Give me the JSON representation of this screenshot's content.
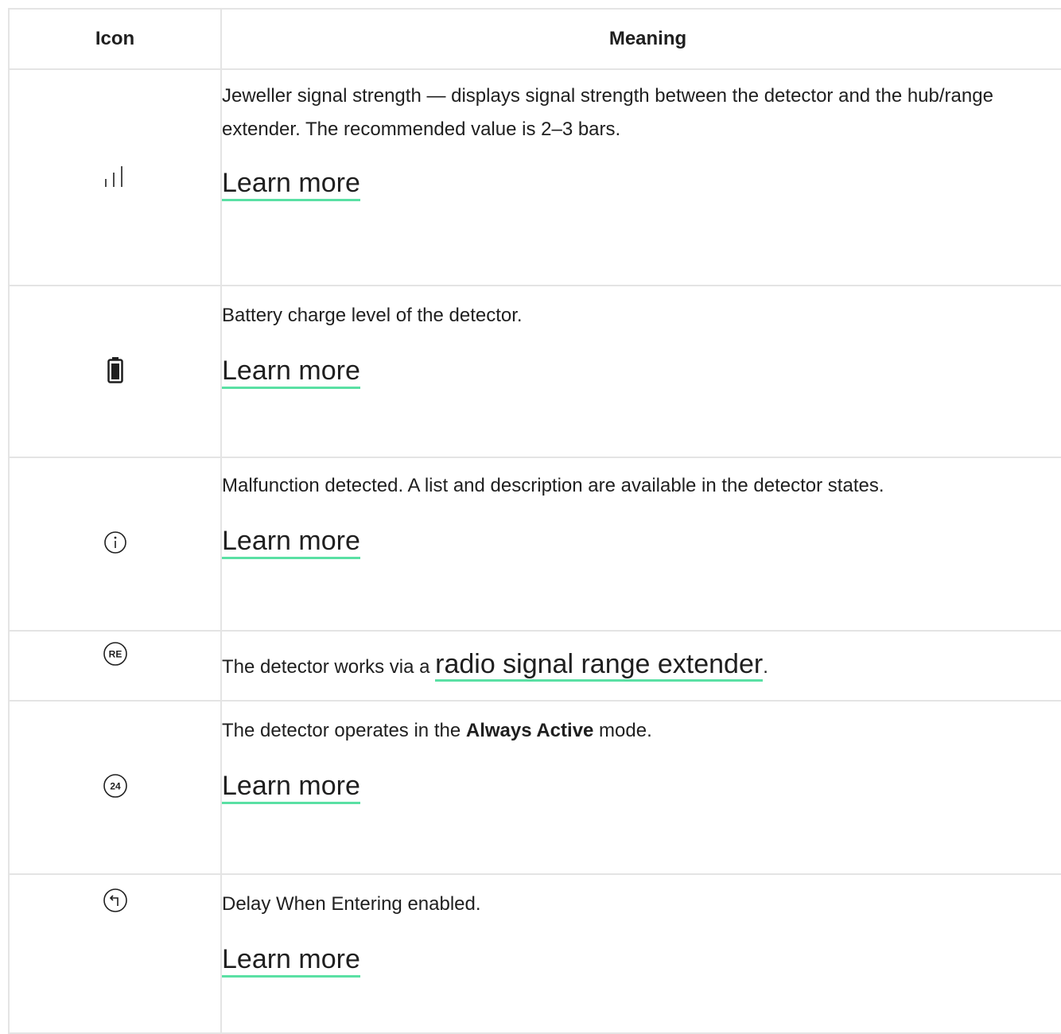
{
  "table": {
    "headers": {
      "icon": "Icon",
      "meaning": "Meaning"
    },
    "rows": [
      {
        "icon": "signal-strength-icon",
        "description": "Jeweller signal strength — displays signal strength between the detector and the hub/range extender. The recommended value is 2–3 bars.",
        "link": "Learn more"
      },
      {
        "icon": "battery-icon",
        "description": "Battery charge level of the detector.",
        "link": "Learn more"
      },
      {
        "icon": "info-icon",
        "description": "Malfunction detected. A list and description are available in the detector states.",
        "link": "Learn more"
      },
      {
        "icon": "range-extender-icon",
        "icon_text": "RE",
        "description_before": "The detector works via a ",
        "link": "radio signal range extender",
        "description_after": "."
      },
      {
        "icon": "always-active-icon",
        "icon_text": "24",
        "description_before": "The detector operates in the ",
        "description_bold": "Always Active",
        "description_after": " mode.",
        "link": "Learn more"
      },
      {
        "icon": "entry-delay-icon",
        "description": "Delay When Entering enabled.",
        "link": "Learn more"
      }
    ]
  },
  "colors": {
    "link_underline": "#5ae0a4",
    "border": "#e4e4e4",
    "text": "#1f1f1f"
  }
}
